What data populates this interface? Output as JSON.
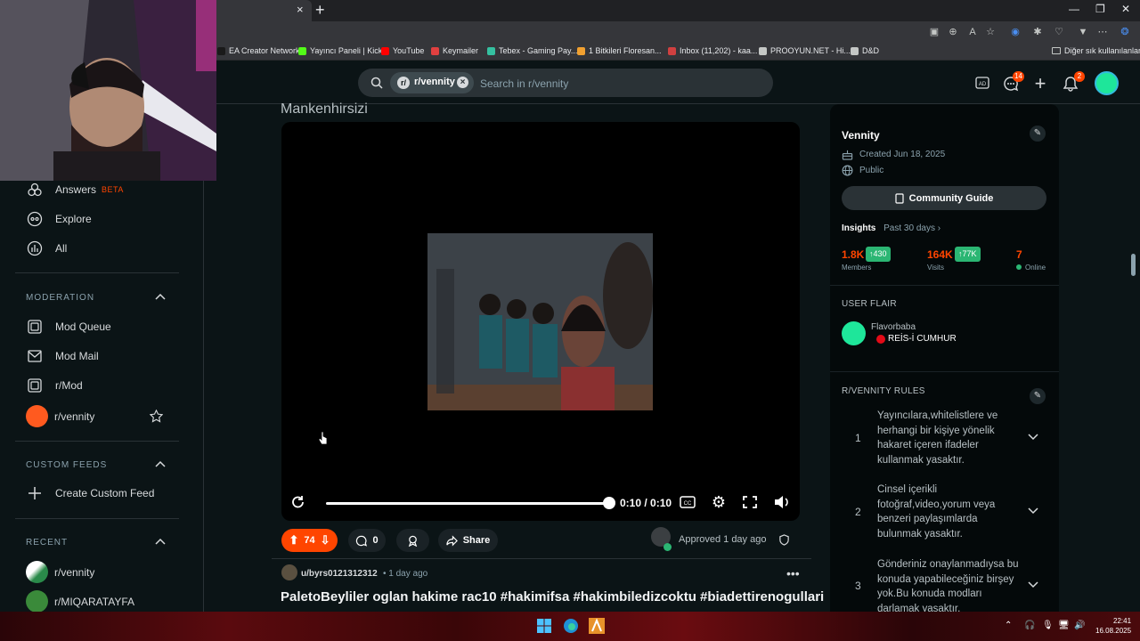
{
  "browser": {
    "tab_close": "×",
    "new_tab": "+",
    "bookmarks": [
      {
        "label": "EA Creator Network",
        "color": "#1a1a1a"
      },
      {
        "label": "Yayıncı Paneli | Kick",
        "color": "#53fc18"
      },
      {
        "label": "YouTube",
        "color": "#ff0000"
      },
      {
        "label": "Keymailer",
        "color": "#e04040"
      },
      {
        "label": "Tebex - Gaming Pay...",
        "color": "#35c0a0"
      },
      {
        "label": "1 Bitkileri Floresan...",
        "color": "#f0a030"
      },
      {
        "label": "Inbox (11,202) - kaa...",
        "color": "#d04040"
      },
      {
        "label": "PROOYUN.NET - Hi...",
        "color": "#c4c7c5"
      },
      {
        "label": "D&D",
        "color": "#c4c7c5"
      }
    ],
    "other_bookmarks": "Diğer sık kullanılanlar"
  },
  "header": {
    "search_chip": "r/vennity",
    "search_chip_avatar": "r/",
    "search_placeholder": "Search in r/vennity",
    "chat_badge": "14",
    "notif_badge": "2"
  },
  "sidebar": {
    "top_items": [
      {
        "label": "Answers",
        "icon": "answers-icon",
        "beta": "BETA"
      },
      {
        "label": "Explore",
        "icon": "explore-icon"
      },
      {
        "label": "All",
        "icon": "all-icon"
      }
    ],
    "moderation_title": "MODERATION",
    "moderation_items": [
      {
        "label": "Mod Queue",
        "icon": "mod-queue-icon"
      },
      {
        "label": "Mod Mail",
        "icon": "mod-mail-icon"
      },
      {
        "label": "r/Mod",
        "icon": "mod-icon"
      },
      {
        "label": "r/vennity",
        "icon": "vennity-avatar"
      }
    ],
    "custom_feeds_title": "CUSTOM FEEDS",
    "create_feed": "Create Custom Feed",
    "recent_title": "RECENT",
    "recent_items": [
      {
        "label": "r/vennity"
      },
      {
        "label": "r/MIQARATAYFA"
      }
    ]
  },
  "post": {
    "title": "Mankenhirsizi",
    "time": "0:10 / 0:10",
    "progress": 1.0,
    "votes": "74",
    "comments": "0",
    "share": "Share",
    "approved": "Approved 1 day ago"
  },
  "next_post": {
    "user": "u/byrs0121312312",
    "time": "• 1 day ago",
    "more": "•••",
    "title": "PaletoBeyliler oglan hakime rac10 #hakimifsa #hakimbiledizcoktu #biadettirenogullari"
  },
  "community": {
    "name": "Vennity",
    "created": "Created Jun 18, 2025",
    "visibility": "Public",
    "guide": "Community Guide",
    "insights_label": "Insights",
    "insights_period": "Past 30 days ›",
    "stats": [
      {
        "value": "1.8K",
        "label": "Members",
        "badge": "↑430"
      },
      {
        "value": "164K",
        "label": "Visits",
        "badge": "↑77K"
      },
      {
        "value": "7",
        "label": "Online"
      }
    ],
    "user_flair_title": "USER FLAIR",
    "flair_user": "Flavorbaba",
    "flair_tag": "REİS-İ CUMHUR",
    "rules_title": "R/VENNITY RULES",
    "rules": [
      {
        "num": "1",
        "text": "Yayıncılara,whitelistlere ve herhangi bir kişiye yönelik hakaret içeren ifadeler kullanmak yasaktır."
      },
      {
        "num": "2",
        "text": "Cinsel içerikli fotoğraf,video,yorum veya benzeri paylaşımlarda bulunmak yasaktır."
      },
      {
        "num": "3",
        "text": "Gönderiniz onaylanmadıysa bu konuda yapabileceğiniz birşey yok.Bu konuda modları darlamak yasaktır."
      }
    ]
  },
  "taskbar": {
    "time": "22:41",
    "date": "16.08.2025"
  },
  "colors": {
    "accent": "#ff4500",
    "green": "#2bb673",
    "bg": "#0b1416"
  }
}
